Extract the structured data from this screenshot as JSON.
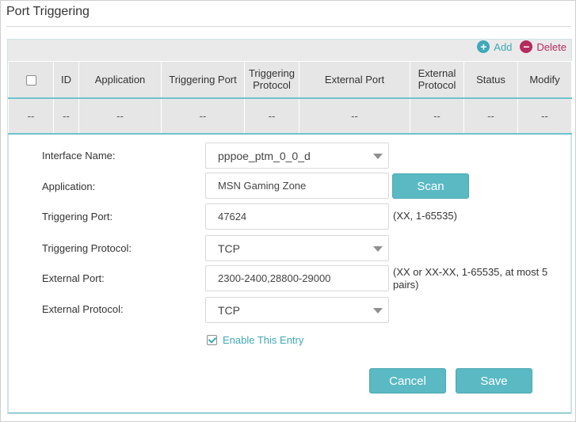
{
  "page": {
    "title": "Port Triggering"
  },
  "toolbar": {
    "add_label": "Add",
    "delete_label": "Delete"
  },
  "table": {
    "headers": {
      "id": "ID",
      "application": "Application",
      "triggering_port": "Triggering Port",
      "triggering_protocol_1": "Triggering",
      "triggering_protocol_2": "Protocol",
      "external_port": "External Port",
      "external_protocol_1": "External",
      "external_protocol_2": "Protocol",
      "status": "Status",
      "modify": "Modify"
    },
    "row": [
      "--",
      "--",
      "--",
      "--",
      "--",
      "--",
      "--",
      "--",
      "--"
    ]
  },
  "form": {
    "interface_name": {
      "label": "Interface Name:",
      "value": "pppoe_ptm_0_0_d"
    },
    "application": {
      "label": "Application:",
      "value": "MSN Gaming Zone",
      "scan_label": "Scan"
    },
    "triggering_port": {
      "label": "Triggering Port:",
      "value": "47624",
      "hint": "(XX, 1-65535)"
    },
    "triggering_protocol": {
      "label": "Triggering Protocol:",
      "value": "TCP"
    },
    "external_port": {
      "label": "External Port:",
      "value": "2300-2400,28800-29000",
      "hint_line1": "(XX or XX-XX, 1-65535, at most 5",
      "hint_line2": "pairs)"
    },
    "external_protocol": {
      "label": "External Protocol:",
      "value": "TCP"
    },
    "enable_entry": {
      "label": "Enable This Entry",
      "checked": true
    },
    "cancel_label": "Cancel",
    "save_label": "Save"
  },
  "colors": {
    "accent": "#5ab9c3",
    "delete": "#b42b5e"
  }
}
